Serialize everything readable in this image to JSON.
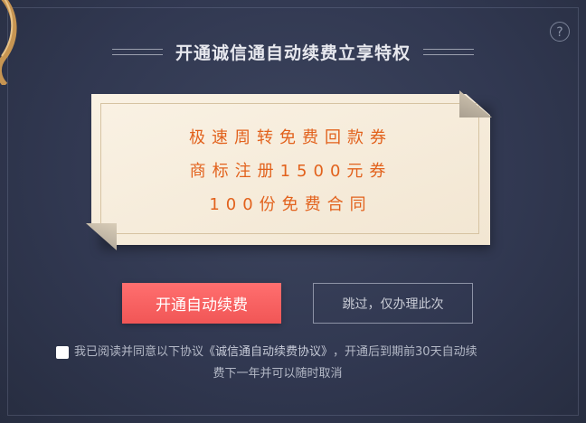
{
  "dialog": {
    "help_label": "?",
    "title": "开通诚信通自动续费立享特权"
  },
  "card": {
    "benefits": [
      "极速周转免费回款券",
      "商标注册1500元券",
      "100份免费合同"
    ]
  },
  "actions": {
    "primary_label": "开通自动续费",
    "secondary_label": "跳过，仅办理此次"
  },
  "agreement": {
    "prefix": "我已阅读并同意以下协议",
    "link": "《诚信通自动续费协议》",
    "suffix": "，开通后到期前30天自动续",
    "line2": "费下一年并可以随时取消",
    "checked": false
  },
  "colors": {
    "background": "#313851",
    "accent": "#f15656",
    "benefit_text": "#e2621d",
    "card_paper": "#f6ecdb"
  },
  "icons": {
    "help": "question-mark-circle-icon",
    "corner_decoration": "gold-ribbon-icon"
  }
}
